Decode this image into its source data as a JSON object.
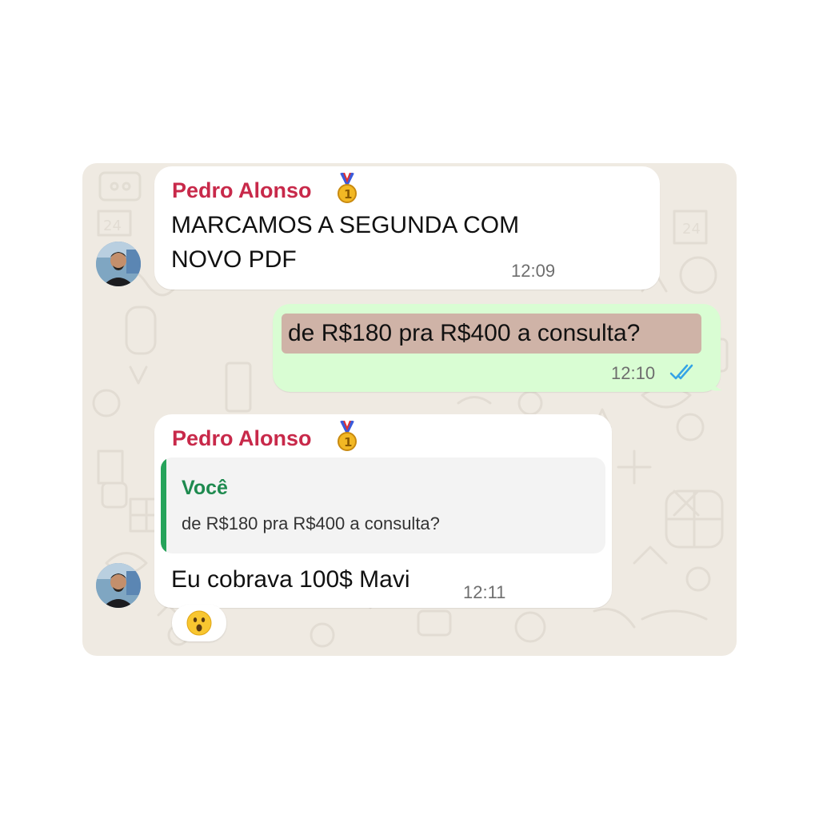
{
  "messages": [
    {
      "sender": "Pedro Alonso",
      "sender_badge_icon": "1st-place-medal-icon",
      "text_lines": [
        "MARCAMOS A SEGUNDA COM",
        "NOVO PDF"
      ],
      "time": "12:09"
    },
    {
      "outgoing": true,
      "text": "de R$180 pra R$400 a consulta?",
      "time": "12:10",
      "status_icon": "double-check-read-icon"
    },
    {
      "sender": "Pedro Alonso",
      "sender_badge_icon": "1st-place-medal-icon",
      "quote": {
        "author": "Você",
        "text": "de R$180 pra R$400 a consulta?"
      },
      "text": "Eu cobrava 100$ Mavi",
      "time": "12:11",
      "reaction_icon": "hushed-face-emoji-icon"
    }
  ],
  "colors": {
    "chat_background": "#efeae2",
    "incoming_bubble": "#ffffff",
    "outgoing_bubble": "#d9fdd3",
    "sender_name": "#c8294a",
    "quote_author": "#1e8a4f",
    "quote_bar": "#25a35a",
    "read_ticks": "#34a3e6"
  }
}
